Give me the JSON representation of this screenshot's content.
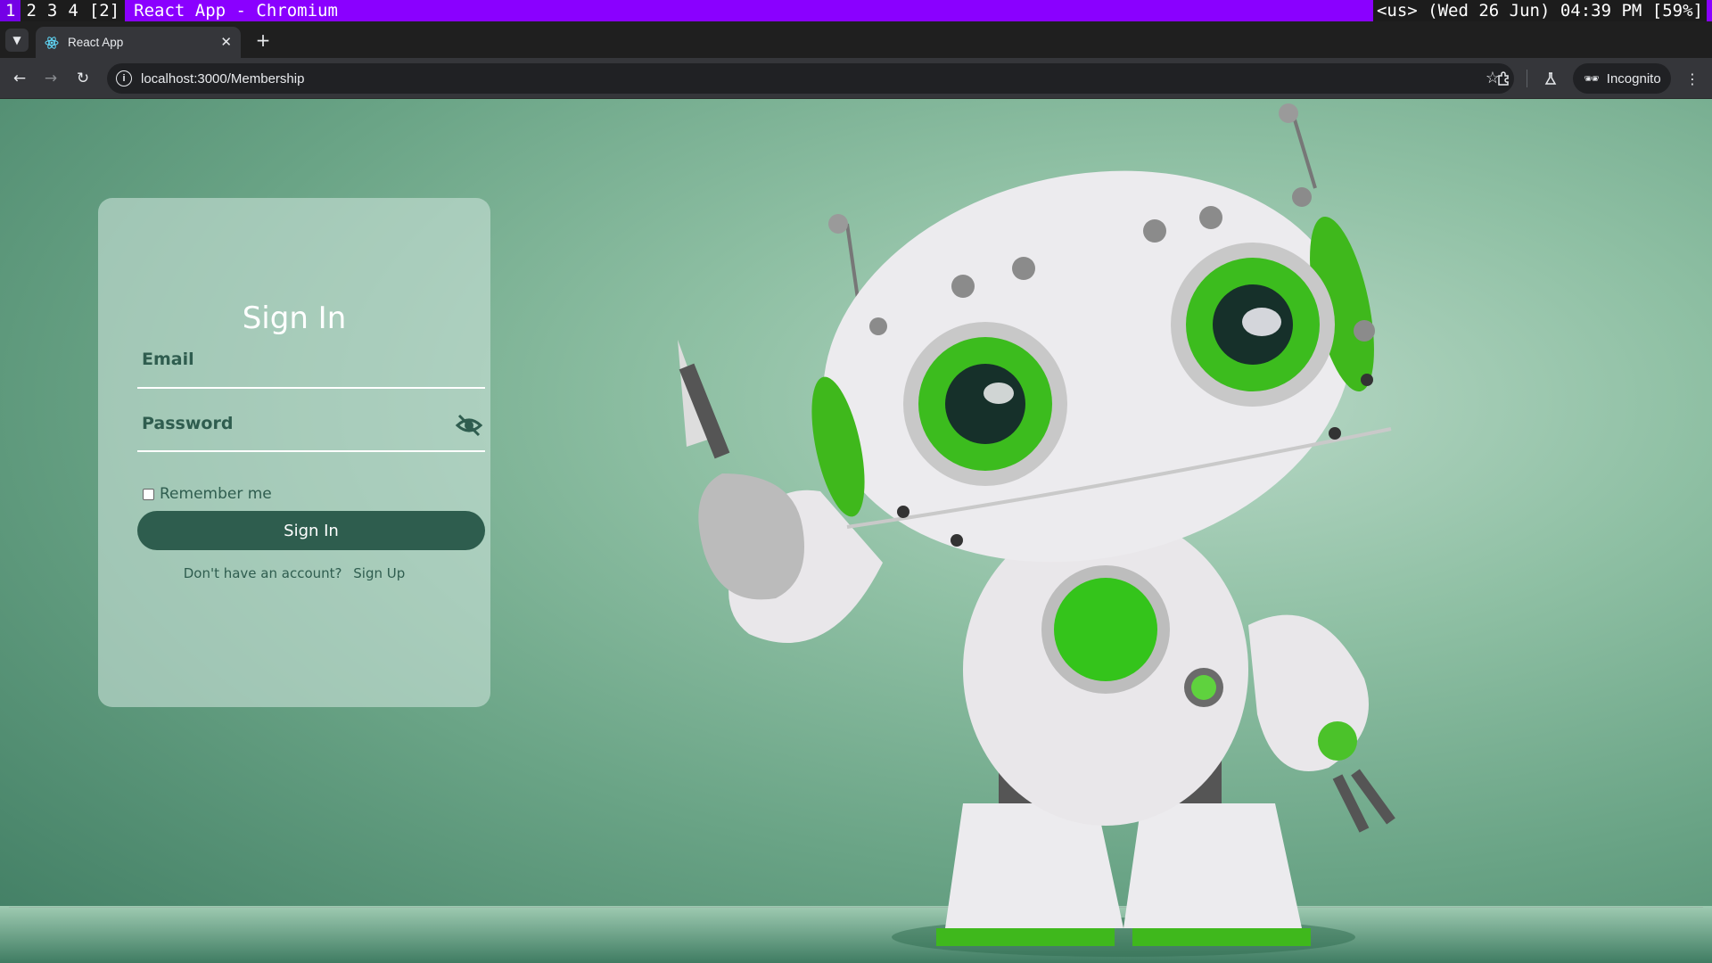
{
  "wm": {
    "workspaces": [
      "1",
      "2",
      "3",
      "4"
    ],
    "window_count": "[2]",
    "title": "React App - Chromium",
    "status": "<us> (Wed 26 Jun) 04:39 PM [59%]"
  },
  "browser": {
    "tab_title": "React App",
    "url": "localhost:3000/Membership",
    "incognito_label": "Incognito"
  },
  "signin": {
    "title": "Sign In",
    "email_label": "Email",
    "password_label": "Password",
    "remember_label": "Remember me",
    "submit_label": "Sign In",
    "no_account_text": "Don't have an account?",
    "signup_link": "Sign Up"
  },
  "colors": {
    "accent": "#2e5d4e",
    "wm_bar": "#8a00ff"
  }
}
